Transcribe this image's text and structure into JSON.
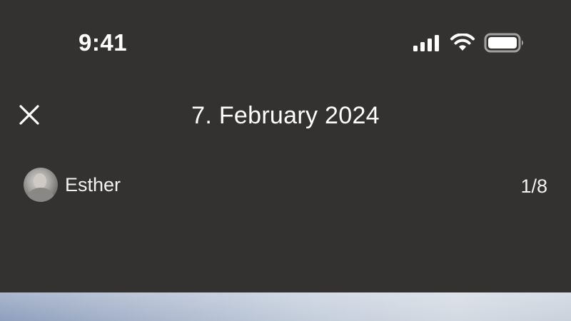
{
  "status_bar": {
    "time": "9:41",
    "icons": [
      "signal-icon",
      "wifi-icon",
      "battery-icon"
    ]
  },
  "header": {
    "title": "7. February 2024",
    "close_icon": "close-icon"
  },
  "author": {
    "name": "Esther",
    "avatar_icon": "avatar"
  },
  "pager": {
    "counter": "1/8"
  },
  "colors": {
    "background": "#343230",
    "text": "#ffffff"
  }
}
